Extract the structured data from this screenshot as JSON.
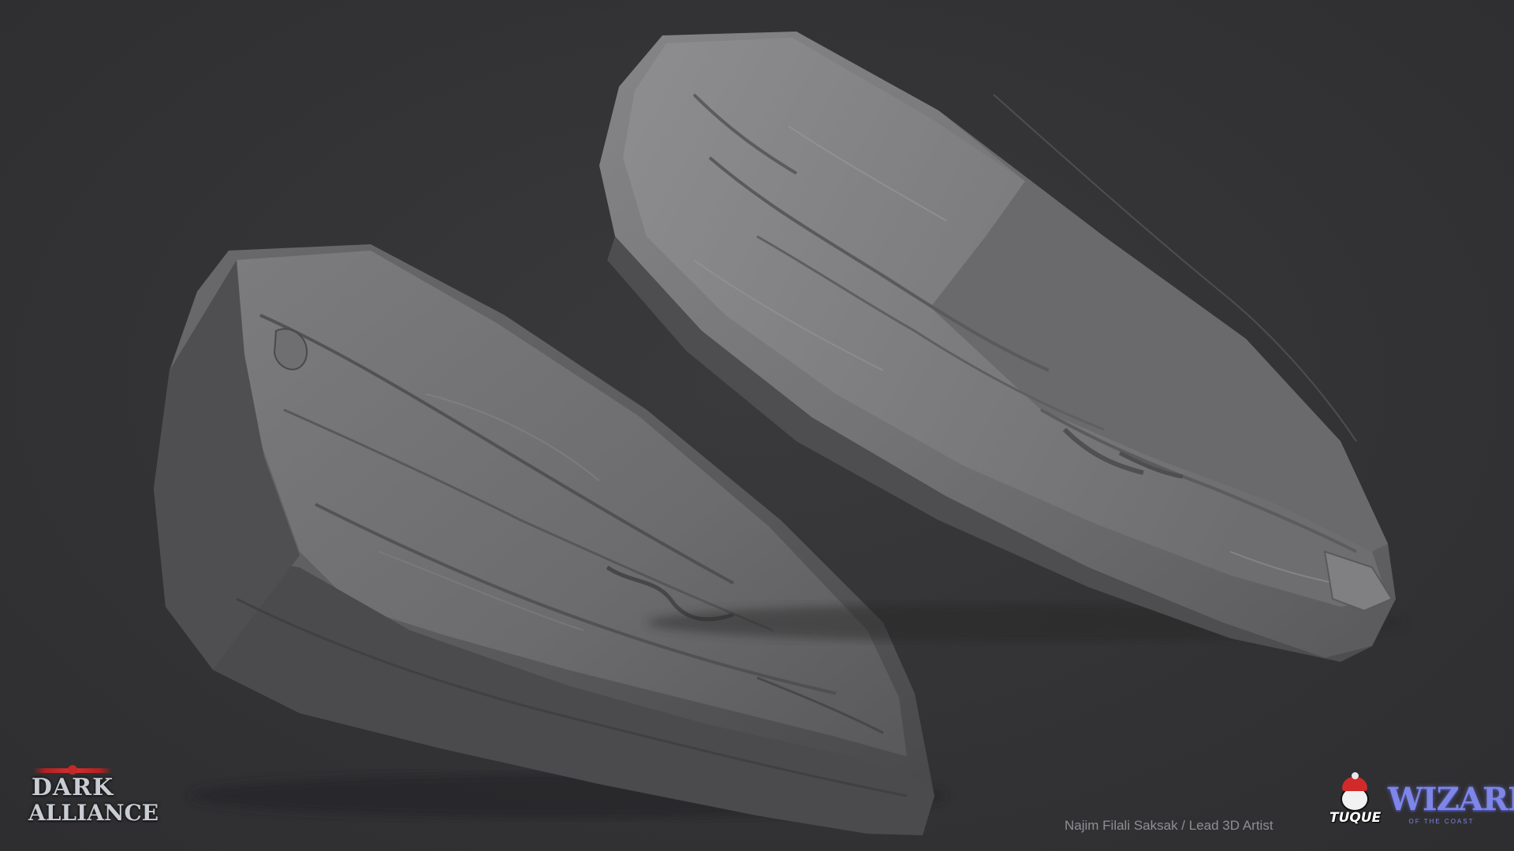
{
  "scene": {
    "description_colors": {
      "background": "#333335",
      "rock_base": "#5c5c5e",
      "rock_light": "#8a8a8c",
      "rock_shadow": "#3f3f41"
    }
  },
  "logos": {
    "game": {
      "line1": "DARK",
      "line2": "ALLIANCE",
      "accent": "#c42828"
    },
    "studio": {
      "name": "TUQUE",
      "accent": "#d22a2a"
    },
    "publisher": {
      "name": "WIZARDS",
      "tagline": "OF THE COAST",
      "accent": "#7e86e8"
    }
  },
  "credit": "Najim Filali Saksak / Lead 3D Artist"
}
